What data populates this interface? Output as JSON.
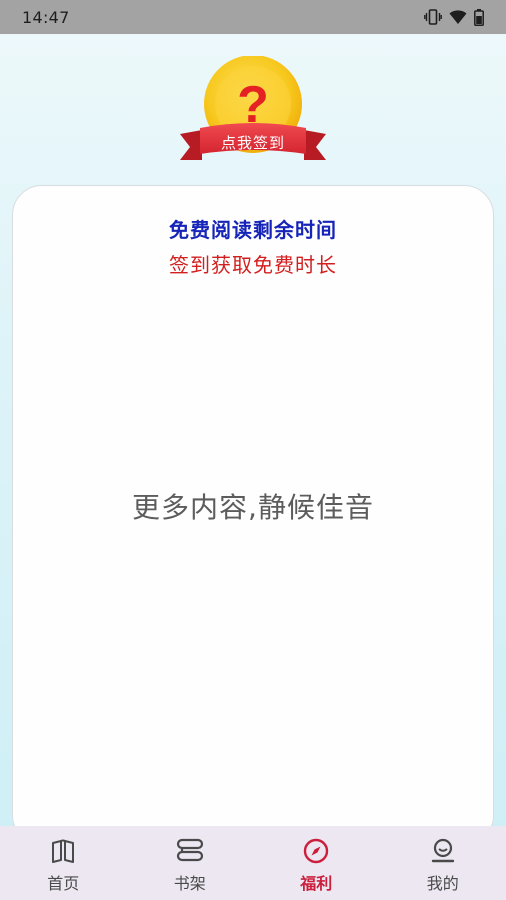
{
  "status_bar": {
    "time": "14:47",
    "icons": [
      "vibrate-icon",
      "wifi-icon",
      "battery-icon"
    ]
  },
  "signin_badge": {
    "symbol": "?",
    "label": "点我签到",
    "colors": {
      "coin": "#f7c81e",
      "ribbon": "#e0313c",
      "symbol": "#e42224"
    }
  },
  "card": {
    "title": "免费阅读剩余时间",
    "subtitle": "签到获取免费时长",
    "message": "更多内容,静候佳音",
    "colors": {
      "title": "#1624b8",
      "subtitle": "#d21f1f"
    }
  },
  "tabbar": {
    "active_color": "#cc1f3c",
    "tabs": [
      {
        "label": "首页",
        "icon": "book-icon",
        "active": false
      },
      {
        "label": "书架",
        "icon": "bookshelf-icon",
        "active": false
      },
      {
        "label": "福利",
        "icon": "compass-icon",
        "active": true
      },
      {
        "label": "我的",
        "icon": "profile-icon",
        "active": false
      }
    ]
  }
}
